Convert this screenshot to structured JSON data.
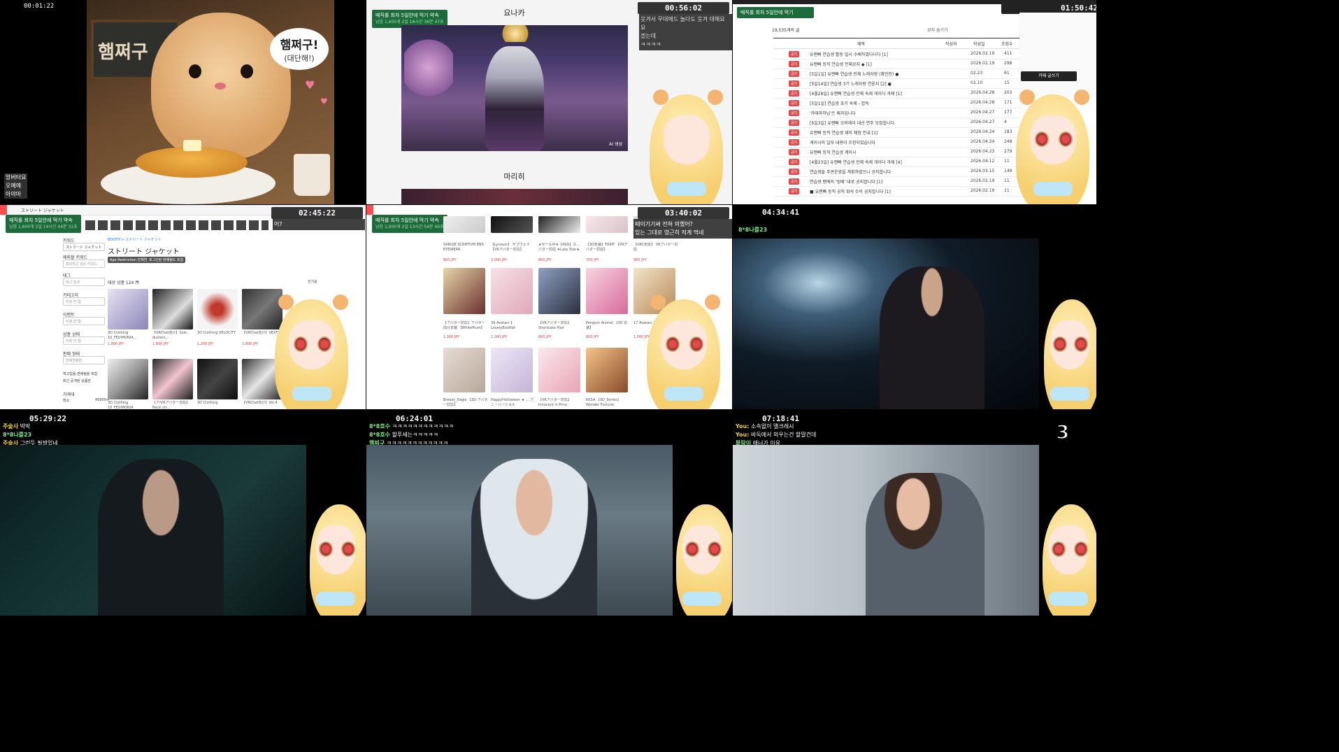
{
  "tiles": {
    "t1": {
      "timer": "00:01:22",
      "sign": "햄쩌구",
      "bubble_main": "햄쩌구!",
      "bubble_sub": "(대단해!)",
      "chat": [
        "앙버터요",
        "오예에",
        "아야마"
      ],
      "colors": {
        "bg": "#5a3d25",
        "hamster": "#e8b77c",
        "pancake": "#e6a33c"
      }
    },
    "t2": {
      "timer": "00:56:02",
      "promo_tag": "매직룰 회차 5일안에 먹기 약속",
      "promo_sub": "남음 1,600개   2일 16시간 36분 47초",
      "heading_top": "요나카",
      "image_caption": "AI 생성",
      "heading_bottom": "마리히",
      "chat": [
        "웃겨서 무대에드 놀다도 웃겨 대해요 요",
        "겠는데",
        "ㅋㅋㅋㅋ"
      ]
    },
    "t3": {
      "timer": "01:50:42",
      "board_count": "19,535개의 글",
      "notice_toggle": "공지 숨기기",
      "columns": [
        "제목",
        "작성자",
        "작성일",
        "조회수"
      ],
      "badge": "공지",
      "rows": [
        {
          "title": "유랜빠 연습생 활동 일시 수배하였다니다 [1]",
          "date": "2026.02.19",
          "views": "411"
        },
        {
          "title": "유랜빠 등직 연습생 전체공지 ◆ [1]",
          "date": "2026.02.19",
          "views": "298"
        },
        {
          "title": "[5일1일] 유랜빠 연습생 전체 노래자랑 (확인안) ●",
          "date": "02.23",
          "views": "61"
        },
        {
          "title": "[5일14일] 연습생 3기 노래자랑 연론지 [2] ●",
          "date": "02.10",
          "views": "15"
        },
        {
          "title": "[4월28일] 유랜빠 연습생 전체 숙제 게이다 과제 [1]",
          "date": "2026.04.28",
          "views": "203"
        },
        {
          "title": "[5일1일] 연습생 초기 숙제 - 합득",
          "date": "2026.04.28",
          "views": "171"
        },
        {
          "title": "'카테마하님'은 패과입니다",
          "date": "2026.04.27",
          "views": "177"
        },
        {
          "title": "[5일3일] 유랜빠 오버레이 대선 연주 모집합니다",
          "date": "2026.04.27",
          "views": "4"
        },
        {
          "title": "유랜빠 등직 연습생 재미 체험 안내 [1]",
          "date": "2026.04.24",
          "views": "183"
        },
        {
          "title": "게이시의 일부 내용이 조정되었습니다",
          "date": "2026.04.24",
          "views": "248"
        },
        {
          "title": "유랜빠 등직 연습생 계이시",
          "date": "2026.04.23",
          "views": "279"
        },
        {
          "title": "[4월23일] 유랜빠 연습생 전체 숙제 게이다 과제 [4]",
          "date": "2026.04.12",
          "views": "11"
        },
        {
          "title": "연습생들 주관운영을 계획하였으니 공지합니다",
          "date": "2026.03.15",
          "views": "149"
        },
        {
          "title": "연습생 팬에의 '빙배' 대로 공지합니다 [1]",
          "date": "2026.02.19",
          "views": "11"
        },
        {
          "title": "■ 유랜빠 등직 공직 화석 수의 공지합니다 [1]",
          "date": "2026.02.19",
          "views": "11"
        }
      ],
      "side_button": "카페 글쓰기"
    },
    "t4": {
      "timer": "02:45:22",
      "crumb_title": "ストリート ジャケット",
      "search_label": "검색",
      "breadcrumb": "BOOTH > ストリート ジャケット",
      "page_title": "ストリート ジャケット",
      "filter_chips": [
        "Age Restriction 전체연령",
        "로그인된 판매됨도 포함"
      ],
      "result_count": "대상 상품 124 件",
      "sort": "인기순",
      "filters": [
        {
          "label": "키워드",
          "value": "ストリート ジャケット"
        },
        {
          "label": "제외할 키워드",
          "value": "제외하고 싶은 키워드"
        },
        {
          "label": "태그",
          "value": "태그 검색"
        },
        {
          "label": "카테고리",
          "value": "지정 안 함"
        },
        {
          "label": "이벤트",
          "value": "지정 안 함"
        },
        {
          "label": "상품 상태",
          "value": "지정 안 함"
        },
        {
          "label": "판매 형태",
          "value": "전체연령만"
        }
      ],
      "checks": [
        "재고없음 판매됨을 포함",
        "최신 공개된 상품만"
      ],
      "price_label": "가격대",
      "price_min": "최소",
      "price_max": "¥5000+",
      "products": [
        {
          "name": "3D Clothing 10_FEVIMONIA...",
          "price": "1,800 JPY"
        },
        {
          "name": "【VRChat向け】Solo dusters...",
          "price": "1,800 JPY"
        },
        {
          "name": "3D Clothing VELOCITY",
          "price": "1,200 JPY"
        },
        {
          "name": "【VRChat向け】VEXTOR...",
          "price": "1,800 JPY"
        },
        {
          "name": "3D Clothing 10_FEVIMONIA",
          "price": "1,800 JPY"
        },
        {
          "name": "【ア/VRアバター対応】Neck str...",
          "price": "1,600 JPY"
        },
        {
          "name": "3D Clothing",
          "price": "1,800 JPY"
        },
        {
          "name": "【VRChat向け】Vol.4",
          "price": "1,800 JPY"
        }
      ],
      "chat": [
        "어?"
      ]
    },
    "t5": {
      "timer": "03:40:02",
      "promo_tag": "매직룰 회차 5일안에 먹기 약속",
      "promo_sub": "남음 1,600개   2일 13시간 54분 46초",
      "chat": [
        "떼이기기써 전혀 의했어?",
        "있는 그대로 영근히 적게 먹네"
      ],
      "products": [
        {
          "name": "SARIOE SCRIPTUM ENS EYEWEAR",
          "price": "800 JPY"
        },
        {
          "name": "【Lyceum】 サブウェイ 【VRアバター対応】",
          "price": "2,000 JPY"
        },
        {
          "name": "★セール中★【4SD】ス... パター対応 ★Lazy Star★",
          "price": "800 JPY"
        },
        {
          "name": "【3D衣装】TRIPP 【VRアバター対応】",
          "price": "700 JPY"
        },
        {
          "name": "【VRC想定】 VRアバター対応",
          "price": "900 JPY"
        },
        {
          "name": "【アバター対応】アバター向け衣装 【WhitePlum】",
          "price": "1,000 JPY"
        },
        {
          "name": "39 Avatars 】 LovelyBunHat",
          "price": "1,000 JPY"
        },
        {
          "name": "【VRアバター対応】 Shortcake Hair",
          "price": "800 JPY"
        },
        {
          "name": "Penguin Animal 【3D 衣装】",
          "price": "800 JPY"
        },
        {
          "name": "17 Avatars 】... Vol.1",
          "price": "1,000 JPY"
        },
        {
          "name": "Breezy_Eagle 【3D アバター対応】",
          "price": "1,000 JPY"
        },
        {
          "name": "HappyHalloween ★ ... アニ・ハーショル",
          "price": "1,000 JPY"
        },
        {
          "name": "【VRアバター対応】 Innocent × Princ",
          "price": "800 JPY"
        },
        {
          "name": "KKSA 【3D_Series】 Wonder Fortune",
          "price": "1,000 JPY"
        }
      ]
    },
    "t6": {
      "timer": "04:34:41",
      "chat": [
        {
          "user": "8*8나를23",
          "msg": ""
        }
      ]
    },
    "t7": {
      "timer": "05:29:22",
      "chat": [
        {
          "user": "주술사",
          "msg": "박박"
        },
        {
          "user": "8*8나를23",
          "msg": ""
        },
        {
          "user": "주술사",
          "msg": "그런듯 필쌀었네"
        }
      ]
    },
    "t8": {
      "timer": "06:24:01",
      "chat": [
        {
          "user": "8*8호수",
          "msg": "ㅋㅋㅋㅋㅋㅋㅋㅋㅋㅋㅋㅋ"
        },
        {
          "user": "8*8호수",
          "msg": "할푸세는ㅋㅋㅋㅋㅋ"
        },
        {
          "user": "햄찌구",
          "msg": "ㅋㅋㅋㅋㅋㅋㅋㅋㅋㅋㅋㅋ"
        }
      ]
    },
    "t9": {
      "timer": "07:18:41",
      "episode": "3화",
      "chat": [
        {
          "user": "You:",
          "msg": "소속없이 앨크레시"
        },
        {
          "user": "You:",
          "msg": "바둑에서 외우는건 할말건데"
        },
        {
          "user": "몰랑이",
          "msg": "애너가 이유"
        }
      ]
    }
  }
}
